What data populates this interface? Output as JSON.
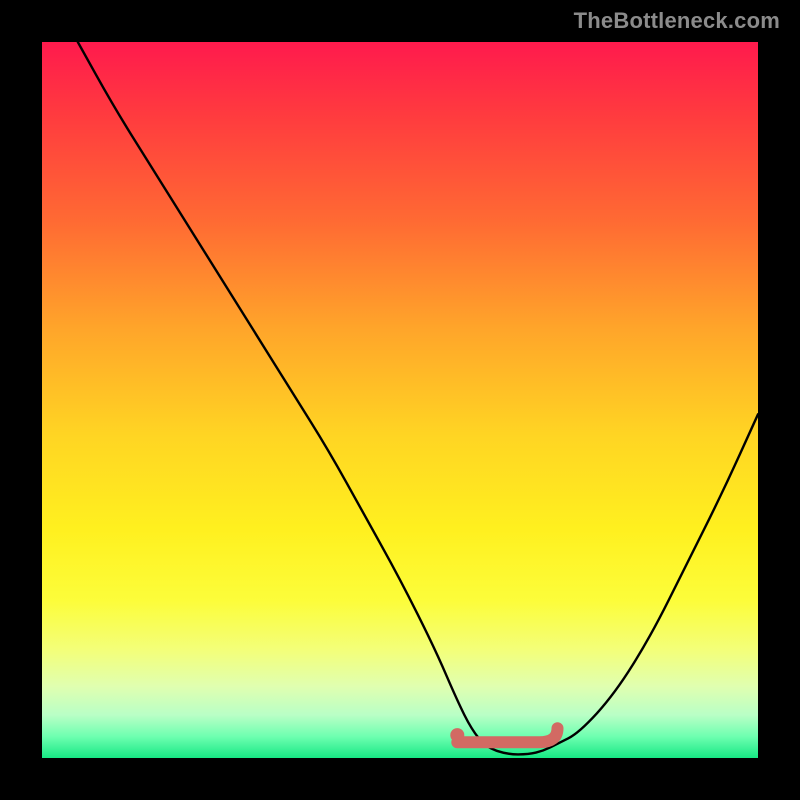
{
  "watermark": "TheBottleneck.com",
  "colors": {
    "curve": "#000000",
    "marker_fill": "#d26a63",
    "marker_stroke": "#d26a63",
    "frame": "#000000"
  },
  "chart_data": {
    "type": "line",
    "title": "",
    "xlabel": "",
    "ylabel": "",
    "xlim": [
      0,
      100
    ],
    "ylim": [
      0,
      100
    ],
    "grid": false,
    "series": [
      {
        "name": "curve",
        "x": [
          5,
          10,
          15,
          20,
          25,
          30,
          35,
          40,
          45,
          50,
          55,
          58,
          60,
          62,
          65,
          68,
          70,
          72,
          75,
          80,
          85,
          90,
          95,
          100
        ],
        "y": [
          100,
          91,
          83,
          75,
          67,
          59,
          51,
          43,
          34,
          25,
          15,
          8,
          4,
          1.5,
          0.5,
          0.5,
          1,
          2,
          3.5,
          9,
          17,
          27,
          37,
          48
        ]
      }
    ],
    "highlight_segment": {
      "name": "optimal-range",
      "x": [
        58,
        72
      ],
      "y": [
        2.2,
        2.2
      ]
    },
    "marker_point": {
      "x": 58,
      "y": 3.2
    }
  }
}
